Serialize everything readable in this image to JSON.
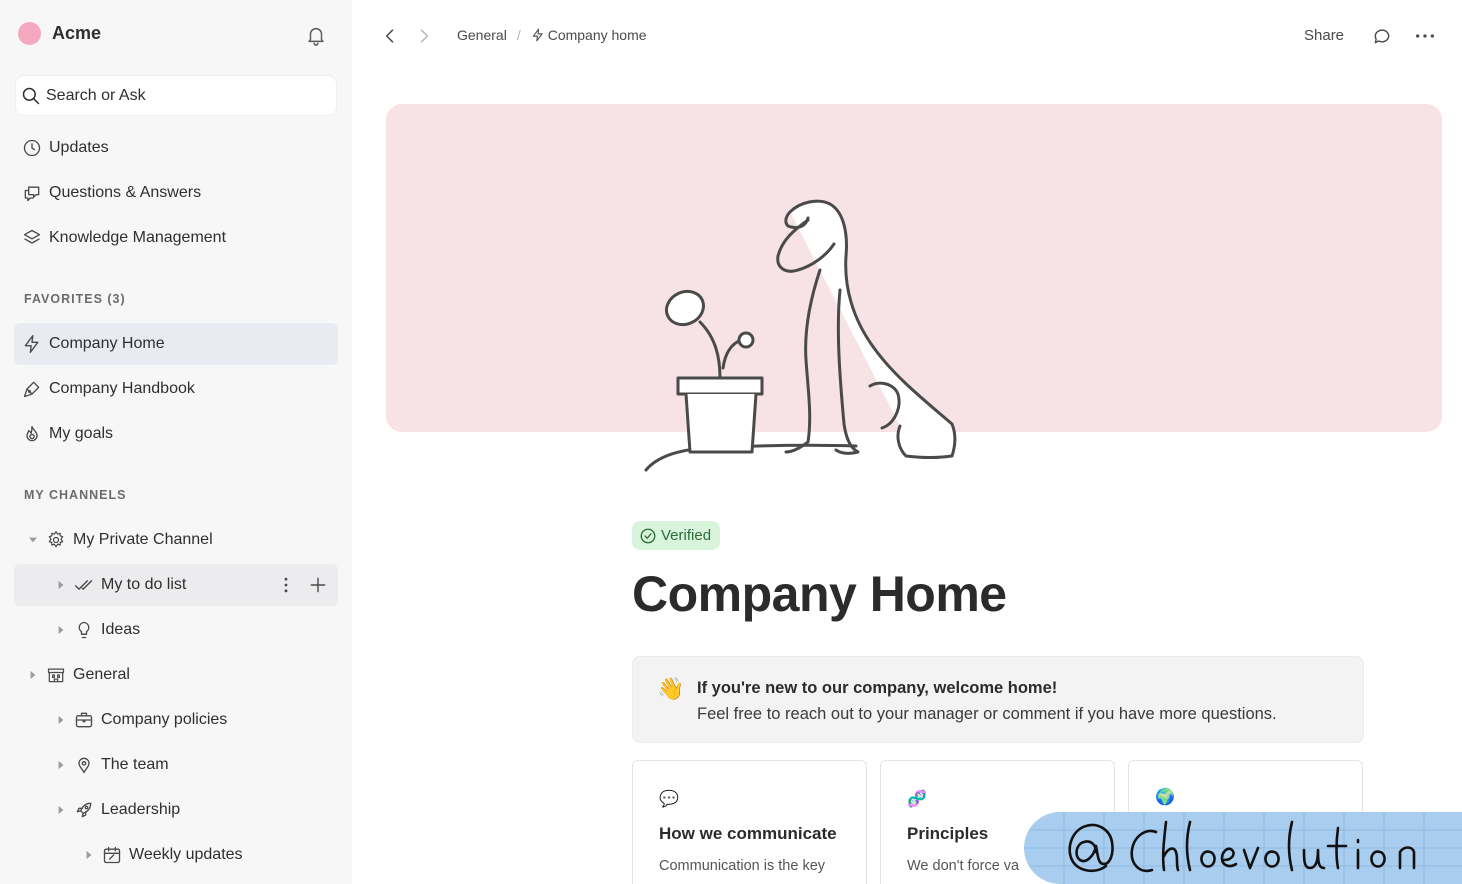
{
  "workspace": {
    "name": "Acme",
    "avatar_color": "#f5a9c0"
  },
  "search": {
    "label": "Search or Ask"
  },
  "nav": [
    {
      "label": "Updates",
      "icon": "clock-icon"
    },
    {
      "label": "Questions & Answers",
      "icon": "chat-bubbles-icon"
    },
    {
      "label": "Knowledge Management",
      "icon": "layers-icon"
    }
  ],
  "favorites": {
    "label": "FAVORITES (3)",
    "items": [
      {
        "label": "Company Home",
        "icon": "lightning-icon",
        "active": true
      },
      {
        "label": "Company Handbook",
        "icon": "pen-tool-icon"
      },
      {
        "label": "My goals",
        "icon": "flame-icon"
      }
    ]
  },
  "channels": {
    "label": "MY CHANNELS",
    "items": [
      {
        "label": "My Private Channel",
        "icon": "puzzle-icon"
      },
      {
        "label": "My to do list",
        "icon": "double-check-icon"
      },
      {
        "label": "Ideas",
        "icon": "lightbulb-icon"
      },
      {
        "label": "General",
        "icon": "building-icon"
      },
      {
        "label": "Company policies",
        "icon": "briefcase-icon"
      },
      {
        "label": "The team",
        "icon": "map-pin-icon"
      },
      {
        "label": "Leadership",
        "icon": "rocket-icon"
      },
      {
        "label": "Weekly updates",
        "icon": "calendar-icon"
      }
    ]
  },
  "breadcrumb": {
    "parent": "General",
    "separator": "/",
    "current": "Company home"
  },
  "topbar": {
    "share_label": "Share"
  },
  "page": {
    "badge": "Verified",
    "title": "Company Home",
    "banner_color": "#f7e2e6",
    "callout": {
      "emoji": "👋",
      "title": "If you're new to our company, welcome home!",
      "text": "Feel free to reach out to your manager or comment if you have more questions."
    },
    "cards": [
      {
        "icon": "💬",
        "title": "How we communicate",
        "text": "Communication is the key"
      },
      {
        "icon": "🧬",
        "title": "Principles",
        "text": "We don't force va"
      },
      {
        "icon": "🌍",
        "title": "",
        "text": ""
      }
    ]
  },
  "watermark": {
    "text": "@ Chloevolution"
  }
}
